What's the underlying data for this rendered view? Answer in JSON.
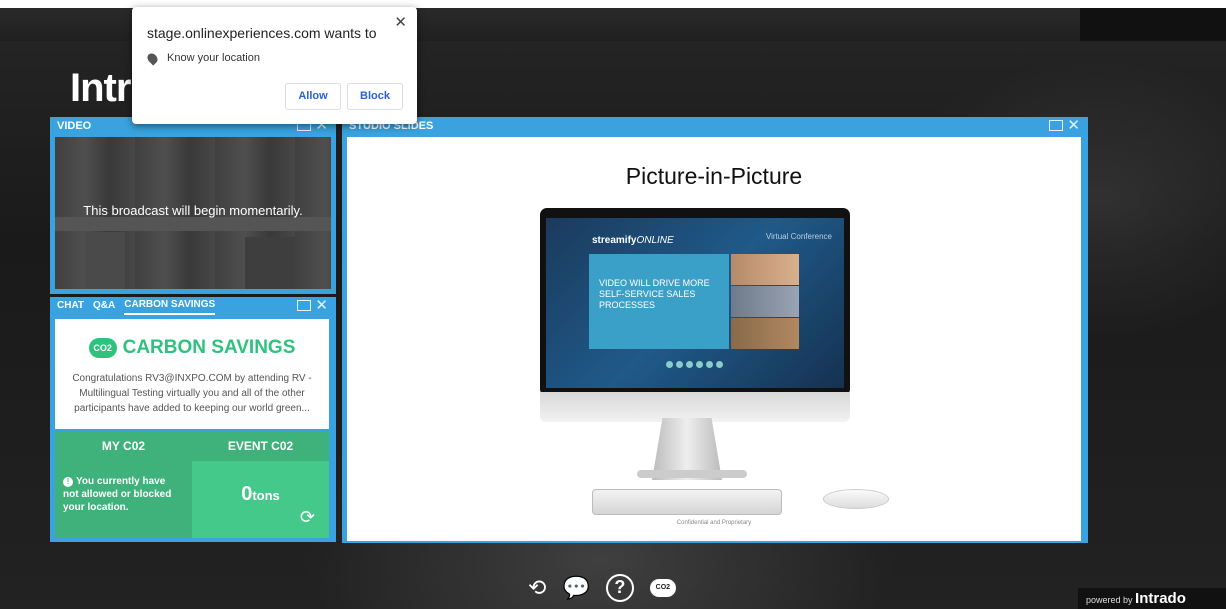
{
  "page": {
    "title": "Intr"
  },
  "permission_popup": {
    "title": "stage.onlinexperiences.com wants to",
    "permission": "Know your location",
    "allow_label": "Allow",
    "block_label": "Block",
    "close_glyph": "✕"
  },
  "video_panel": {
    "title": "VIDEO",
    "message": "This broadcast will begin momentarily."
  },
  "chat_panel": {
    "tabs": [
      {
        "label": "CHAT",
        "active": false
      },
      {
        "label": "Q&A",
        "active": false
      },
      {
        "label": "CARBON SAVINGS",
        "active": true
      }
    ],
    "carbon": {
      "icon_label": "CO2",
      "heading": "CARBON SAVINGS",
      "description": "Congratulations RV3@INXPO.COM by attending RV - Multilingual Testing virtually you and all of the other participants have added to keeping our world green...",
      "my_label": "MY C02",
      "event_label": "EVENT C02",
      "my_message": "You currently have not allowed or blocked your location.",
      "event_value": "0",
      "event_unit": "tons"
    }
  },
  "slides_panel": {
    "title": "STUDIO SLIDES",
    "slide_title": "Picture-in-Picture",
    "brand": "streamify",
    "brand_suffix": "ONLINE",
    "virtual_text": "Virtual Conference",
    "video_text": "VIDEO WILL DRIVE MORE SELF-SERVICE SALES PROCESSES",
    "footer": "Confidential and Proprietary"
  },
  "toolbar": {
    "refresh_glyph": "⟲",
    "chat_glyph": "💬",
    "help_glyph": "?",
    "carbon_label": "CO2"
  },
  "footer": {
    "powered_prefix": "powered by",
    "brand": "Intrado"
  },
  "colors": {
    "panel_blue": "#3aa3df",
    "carbon_green": "#2ec27e",
    "stat_dark": "#3fb17a",
    "stat_light": "#45c98a",
    "link_blue": "#2962d9"
  }
}
